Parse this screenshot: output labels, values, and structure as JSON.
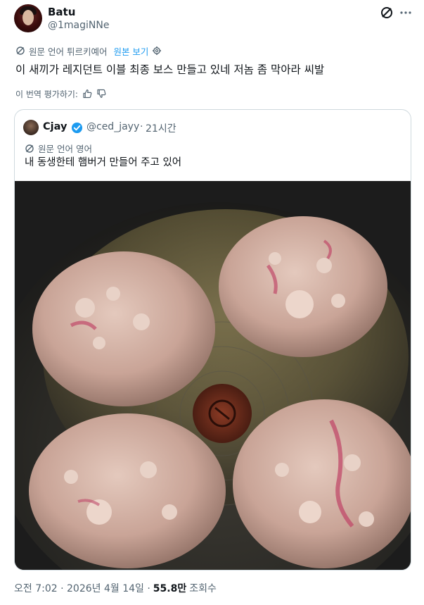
{
  "author": {
    "name": "Batu",
    "handle": "@1magiNNe"
  },
  "header_icons": [
    "grok-icon",
    "more-icon"
  ],
  "translation": {
    "label": "원문 언어 튀르키예어",
    "show_original": "원본 보기"
  },
  "tweet": {
    "text": "이 새끼가 레지던트 이블 최종 보스 만들고 있네 저놈 좀 막아라 씨발"
  },
  "rate": {
    "label": "이 번역 평가하기:"
  },
  "quote": {
    "name": "Cjay",
    "handle": "@ced_jayy",
    "separator": "·",
    "time": "21시간",
    "lang_label": "원문 언어 영어",
    "text": "내 동생한테 햄버거 만들어 주고 있어"
  },
  "footer": {
    "time": "오전 7:02 · 2026년 4월 14일 ·",
    "views": "55.8만",
    "views_label": "조회수"
  },
  "colors": {
    "link": "#1d9bf0",
    "secondary_text": "#536471",
    "border": "#cfd9de"
  }
}
